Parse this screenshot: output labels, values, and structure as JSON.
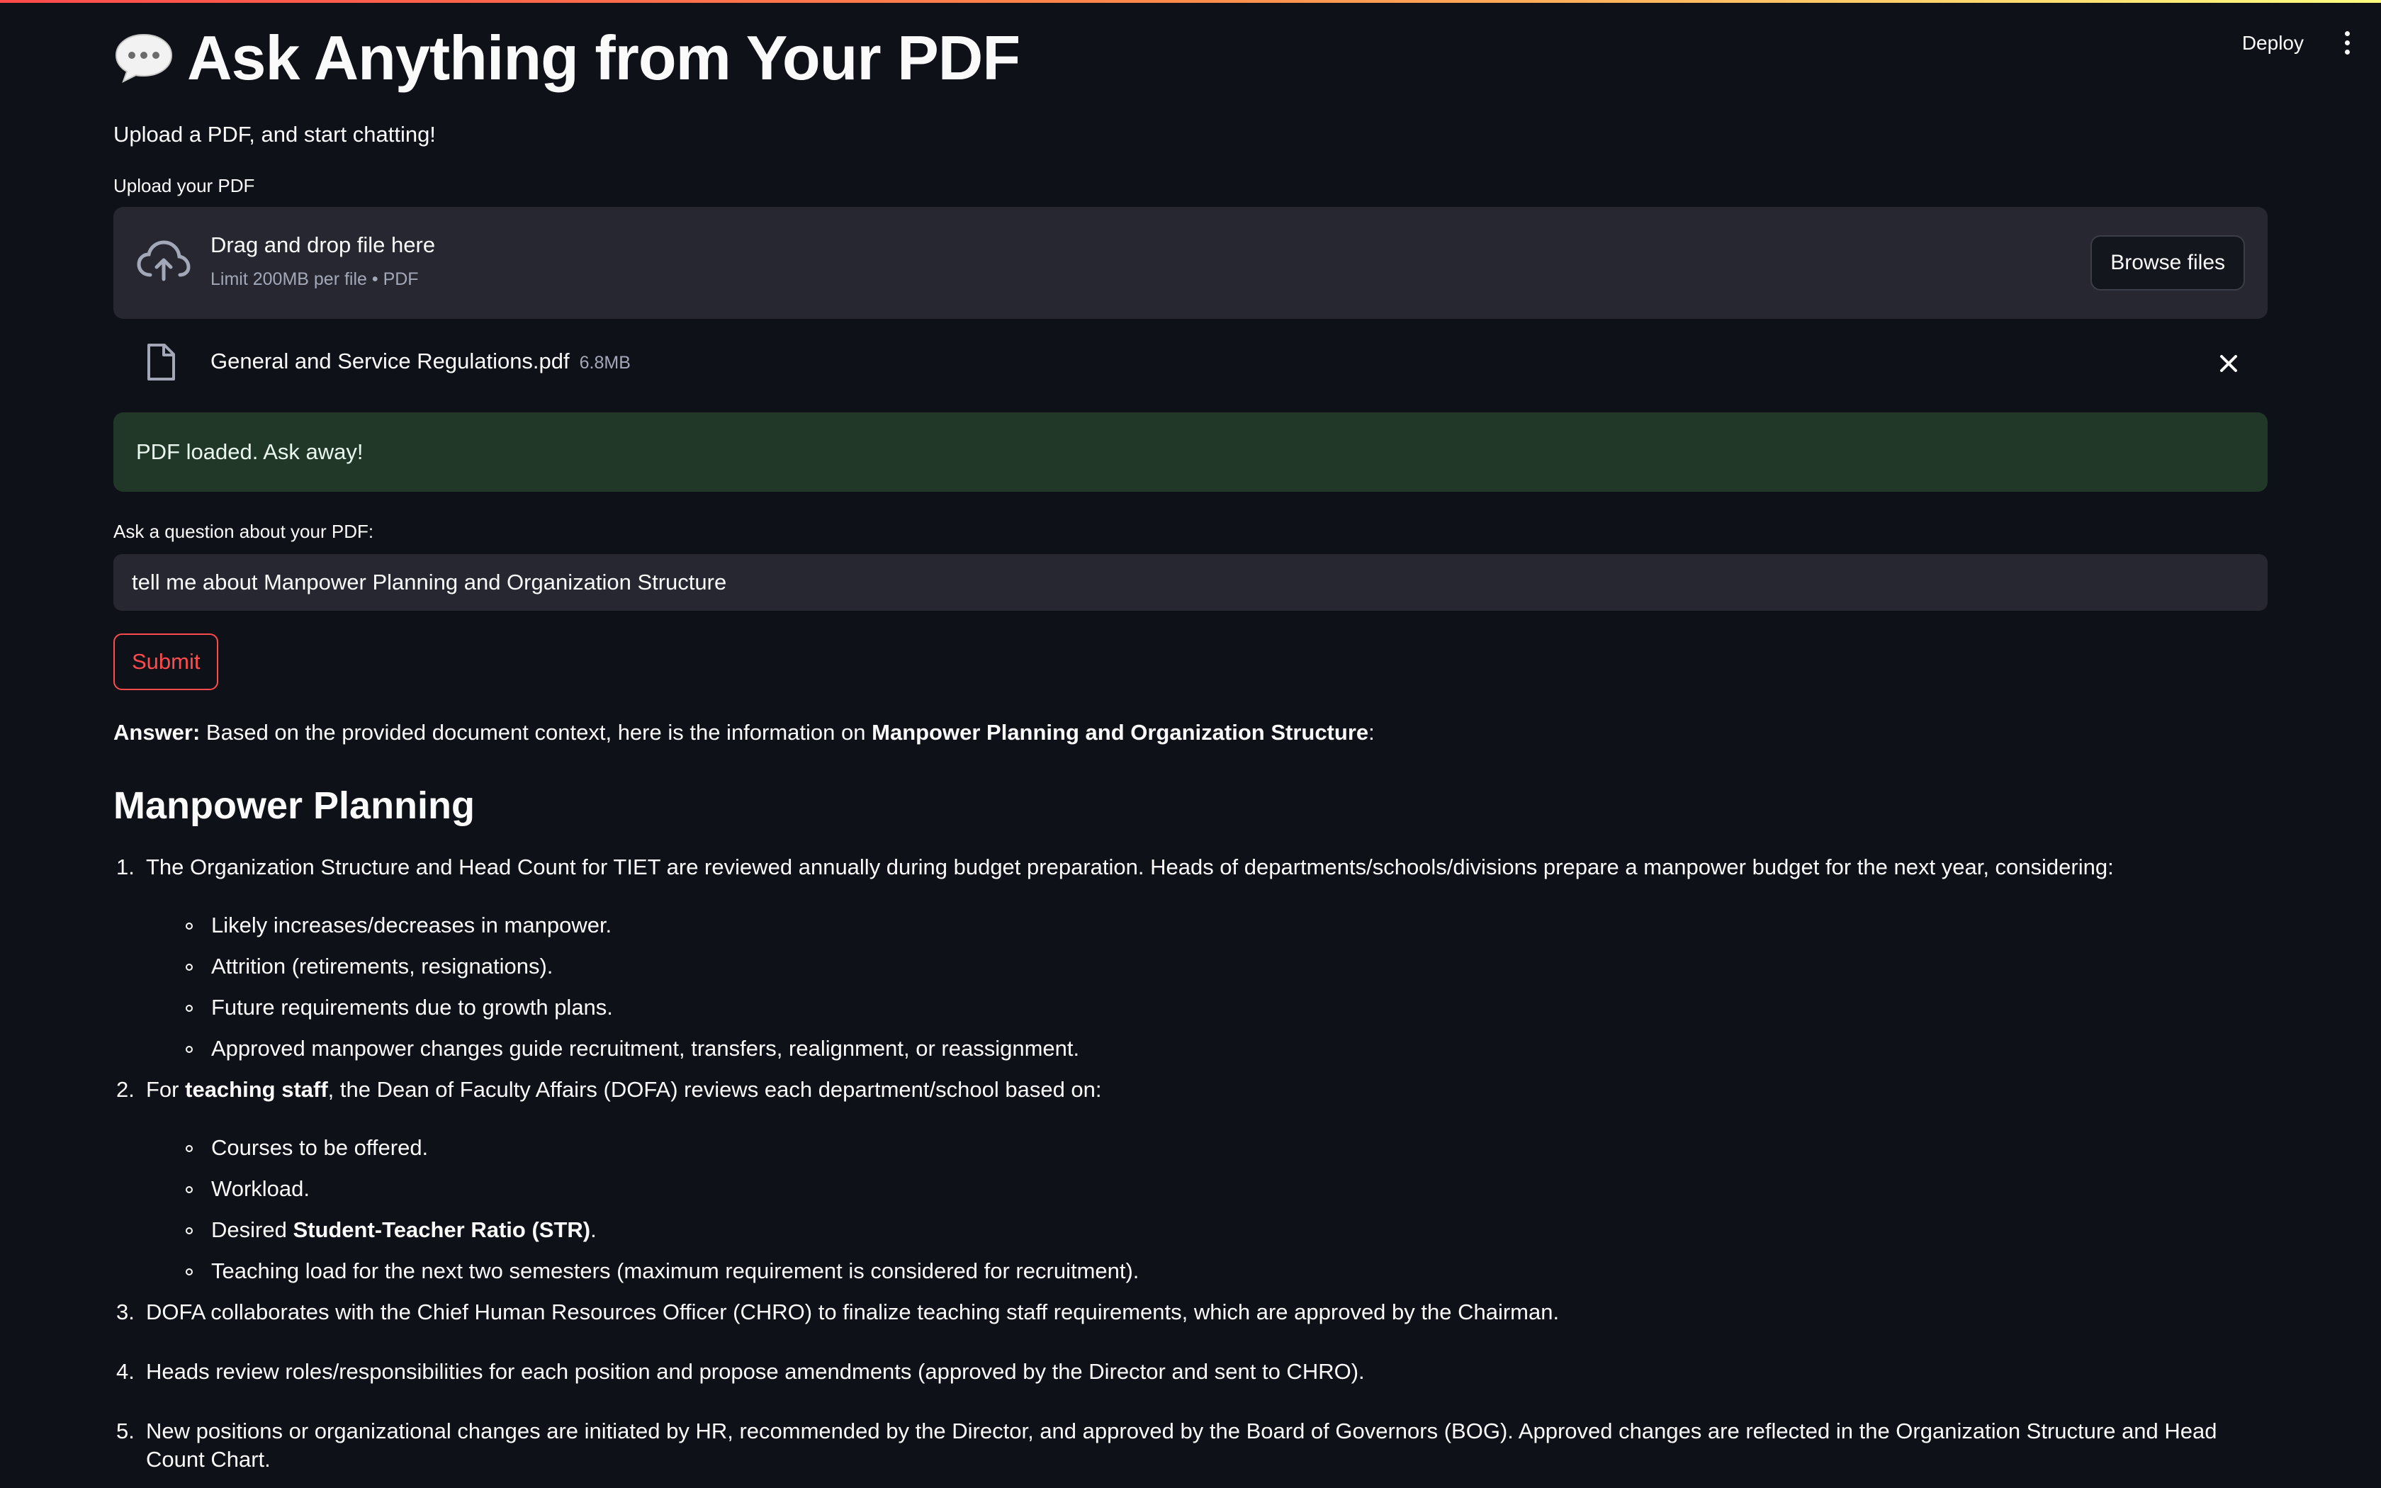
{
  "header": {
    "deploy_label": "Deploy",
    "menu_icon": "kebab-icon"
  },
  "page": {
    "title_emoji_icon": "speech-bubble-icon",
    "title": "Ask Anything from Your PDF",
    "subtitle": "Upload a PDF, and start chatting!"
  },
  "uploader": {
    "label": "Upload your PDF",
    "drop_title": "Drag and drop file here",
    "limit": "Limit 200MB per file • PDF",
    "browse_label": "Browse files",
    "file": {
      "name": "General and Service Regulations.pdf",
      "size": "6.8MB"
    }
  },
  "status": {
    "success_message": "PDF loaded. Ask away!"
  },
  "question": {
    "label": "Ask a question about your PDF:",
    "value": "tell me about Manpower Planning and Organization Structure",
    "submit_label": "Submit"
  },
  "answer": {
    "prefix": "Answer:",
    "intro": " Based on the provided document context, here is the information on ",
    "topic": "Manpower Planning and Organization Structure",
    "suffix": ":",
    "section_title": "Manpower Planning",
    "items": [
      {
        "num": "1.",
        "text": "The Organization Structure and Head Count for TIET are reviewed annually during budget preparation. Heads of departments/schools/divisions prepare a manpower budget for the next year, considering:",
        "subitems": [
          "Likely increases/decreases in manpower.",
          "Attrition (retirements, resignations).",
          "Future requirements due to growth plans.",
          "Approved manpower changes guide recruitment, transfers, realignment, or reassignment."
        ]
      },
      {
        "num": "2.",
        "text_before": "For ",
        "text_bold": "teaching staff",
        "text_after": ", the Dean of Faculty Affairs (DOFA) reviews each department/school based on:",
        "subitems": [
          "Courses to be offered.",
          "Workload.",
          "Desired ",
          "Teaching load for the next two semesters (maximum requirement is considered for recruitment)."
        ],
        "str_bold": "Student-Teacher Ratio (STR)",
        "str_after": "."
      },
      {
        "num": "3.",
        "text": "DOFA collaborates with the Chief Human Resources Officer (CHRO) to finalize teaching staff requirements, which are approved by the Chairman."
      },
      {
        "num": "4.",
        "text": "Heads review roles/responsibilities for each position and propose amendments (approved by the Director and sent to CHRO)."
      },
      {
        "num": "5.",
        "text": "New positions or organizational changes are initiated by HR, recommended by the Director, and approved by the Board of Governors (BOG). Approved changes are reflected in the Organization Structure and Head Count Chart."
      }
    ]
  }
}
